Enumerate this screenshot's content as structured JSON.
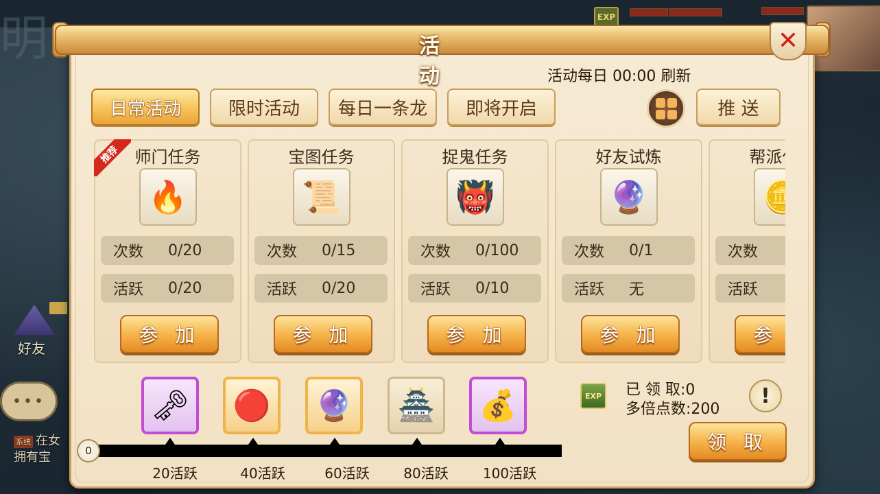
{
  "background": {
    "friend_label": "好友",
    "exp_badge": "EXP",
    "chat_tag": "系统",
    "chat_line1": "在女",
    "chat_line2": "拥有宝",
    "chat_dots": "•••"
  },
  "dialog": {
    "title": "活　动",
    "close_icon": "close-icon",
    "refresh_text": "活动每日 00:00 刷新",
    "tabs": [
      {
        "label": "日常活动",
        "active": true
      },
      {
        "label": "限时活动",
        "active": false
      },
      {
        "label": "每日一条龙",
        "active": false
      },
      {
        "label": "即将开启",
        "active": false
      }
    ],
    "grid_icon": "grid-menu-icon",
    "push_label": "推 送",
    "count_label": "次数",
    "active_label": "活跃",
    "join_label": "参 加",
    "recommend_tag": "推荐",
    "activities": [
      {
        "name": "师门任务",
        "icon": "fire-orb-icon",
        "glyph": "🔥",
        "count": "0/20",
        "activity": "0/20",
        "recommended": true
      },
      {
        "name": "宝图任务",
        "icon": "treasure-map-icon",
        "glyph": "📜",
        "count": "0/15",
        "activity": "0/20",
        "recommended": false
      },
      {
        "name": "捉鬼任务",
        "icon": "ghost-mask-icon",
        "glyph": "👹",
        "count": "0/100",
        "activity": "0/10",
        "recommended": false
      },
      {
        "name": "好友试炼",
        "icon": "purple-orb-icon",
        "glyph": "🔮",
        "count": "0/1",
        "activity": "无",
        "recommended": false
      },
      {
        "name": "帮派任务",
        "icon": "gold-coin-icon",
        "glyph": "🪙",
        "count": "",
        "activity": "",
        "recommended": false
      }
    ],
    "progress": {
      "current": "0",
      "milestones": [
        {
          "label": "20活跃",
          "icon": "golden-key-icon",
          "glyph": "🗝",
          "frame": "purple"
        },
        {
          "label": "40活跃",
          "icon": "fire-gem-icon",
          "glyph": "🔴",
          "frame": "orange"
        },
        {
          "label": "60活跃",
          "icon": "crystal-ball-icon",
          "glyph": "🔮",
          "frame": "orange"
        },
        {
          "label": "80活跃",
          "icon": "golden-pagoda-icon",
          "glyph": "🏯",
          "frame": "plain"
        },
        {
          "label": "100活跃",
          "icon": "lucky-bag-icon",
          "glyph": "💰",
          "frame": "purple"
        }
      ]
    },
    "exp_icon_text": "EXP",
    "claimed_text": "已 领 取:0",
    "multiplier_text": "多倍点数:200",
    "help_glyph": "!",
    "claim_label": "领 取"
  }
}
